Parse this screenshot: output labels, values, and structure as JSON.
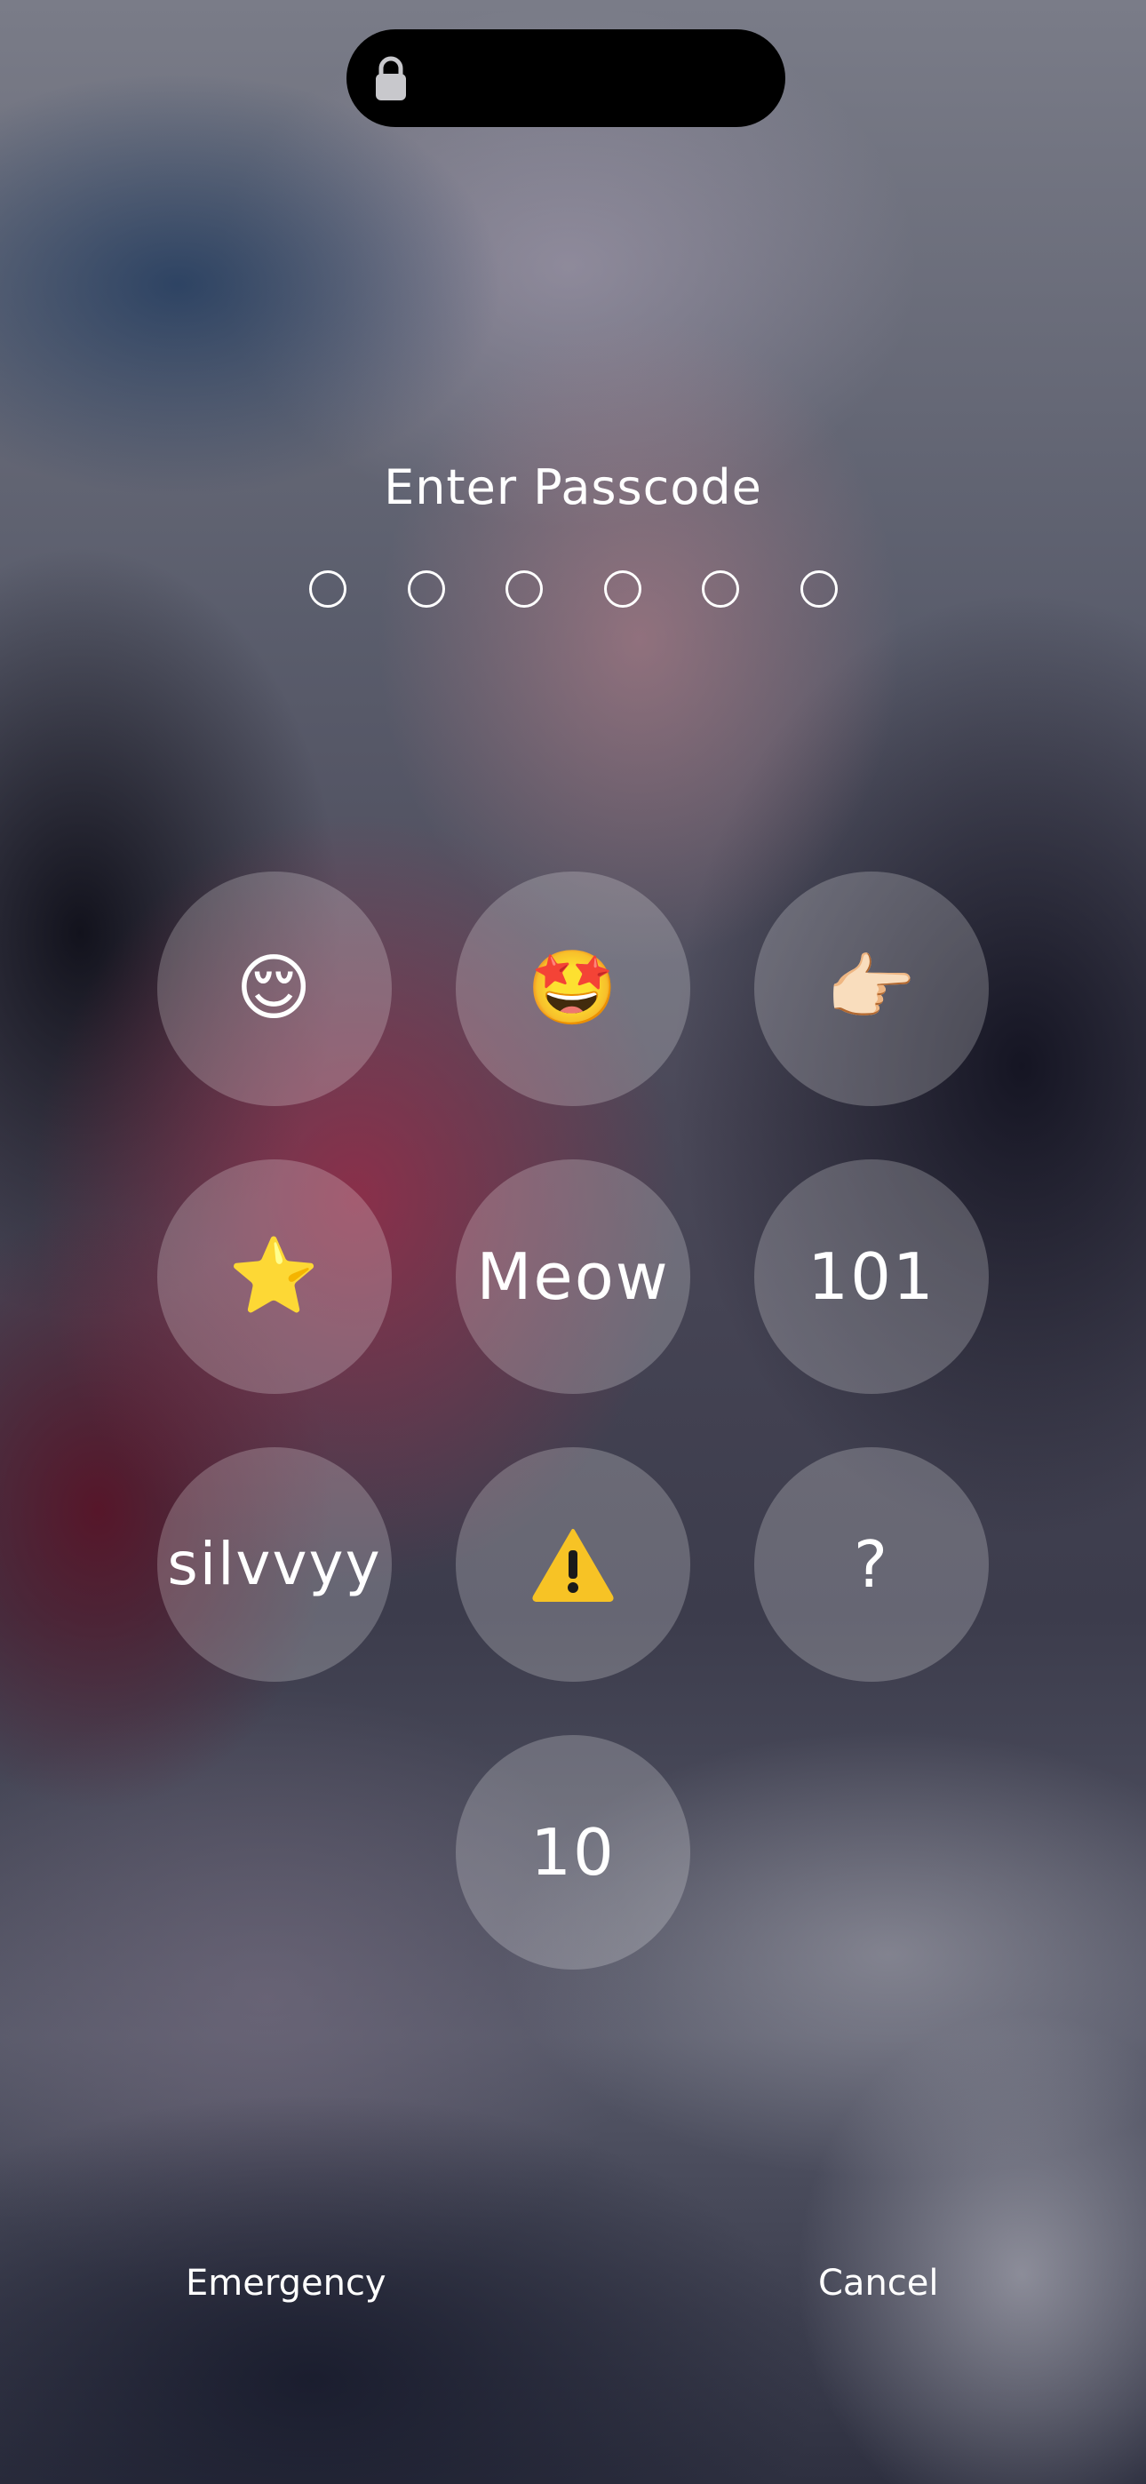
{
  "status_bar": {
    "icon": "lock-icon"
  },
  "passcode": {
    "title": "Enter Passcode",
    "digits_total": 6,
    "digits_entered": 0
  },
  "keypad": {
    "keys": [
      {
        "label": "😌",
        "kind": "emoji"
      },
      {
        "label": "🤩",
        "kind": "emoji"
      },
      {
        "label": "👉🏻",
        "kind": "emoji"
      },
      {
        "label": "⭐",
        "kind": "emoji"
      },
      {
        "label": "Meow",
        "kind": "text"
      },
      {
        "label": "101",
        "kind": "text"
      },
      {
        "label": "silvvyy",
        "kind": "text"
      },
      {
        "label": "⚠️",
        "kind": "icon",
        "icon": "warning-icon"
      },
      {
        "label": "?",
        "kind": "text"
      },
      {
        "label": "10",
        "kind": "text"
      }
    ]
  },
  "footer": {
    "emergency_label": "Emergency",
    "cancel_label": "Cancel"
  },
  "colors": {
    "text": "#ffffff",
    "key_fill": "rgba(255,255,255,0.22)",
    "warning_yellow": "#f7c325"
  }
}
